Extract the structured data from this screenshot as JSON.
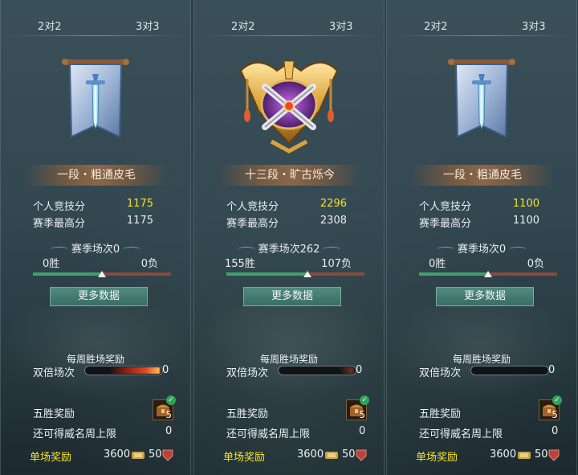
{
  "tabs": {
    "two_v_two": "2对2",
    "three_v_three": "3对3"
  },
  "labels": {
    "personal_score": "个人竞技分",
    "season_high": "赛季最高分",
    "more_data": "更多数据",
    "weekly_reward": "每周胜场奖励",
    "double_matches": "双倍场次",
    "five_win_reward": "五胜奖励",
    "prestige_cap": "还可得威名周上限",
    "single_reward": "单场奖励"
  },
  "panels": [
    {
      "rank": "一段・粗通皮毛",
      "score": "1175",
      "high": "1175",
      "season": "赛季场次0",
      "wins": "0胜",
      "losses": "0负",
      "win_ratio": 0.5,
      "double_value": "0",
      "five_count": "5",
      "cap_value": "0",
      "coins": "3600",
      "honor": "50",
      "emblem": "banner-sword-icon",
      "double_glow": "strong"
    },
    {
      "rank": "十三段・旷古烁今",
      "score": "2296",
      "high": "2308",
      "season": "赛季场次262",
      "wins": "155胜",
      "losses": "107负",
      "win_ratio": 0.59,
      "double_value": "0",
      "five_count": "5",
      "cap_value": "0",
      "coins": "3600",
      "honor": "50",
      "emblem": "golden-crest-icon",
      "double_glow": "faint"
    },
    {
      "rank": "一段・粗通皮毛",
      "score": "1100",
      "high": "1100",
      "season": "赛季场次0",
      "wins": "0胜",
      "losses": "0负",
      "win_ratio": 0.5,
      "double_value": "0",
      "five_count": "5",
      "cap_value": "0",
      "coins": "3600",
      "honor": "50",
      "emblem": "banner-sword-icon",
      "double_glow": "none"
    }
  ],
  "colors": {
    "score": "#f4e32a",
    "single_reward": "#f4e32a",
    "win_bar": "#3fa06e",
    "loss_bar": "#8b4a3a",
    "button": "#3f786c"
  }
}
